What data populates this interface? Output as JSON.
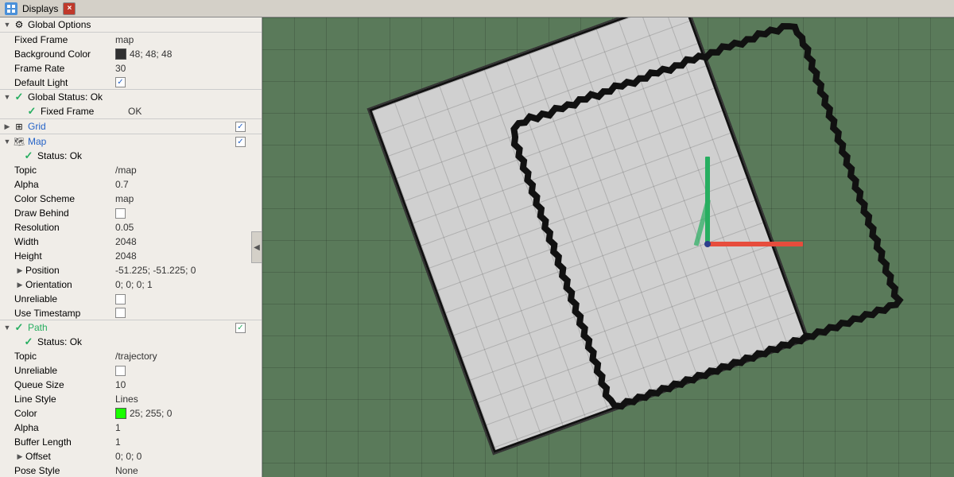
{
  "titlebar": {
    "title": "Displays",
    "close_label": "×"
  },
  "panel": {
    "global_options": {
      "label": "Global Options",
      "fixed_frame": {
        "label": "Fixed Frame",
        "value": "map"
      },
      "background_color": {
        "label": "Background Color",
        "value": "48; 48; 48",
        "swatch": "#303030"
      },
      "frame_rate": {
        "label": "Frame Rate",
        "value": "30"
      },
      "default_light": {
        "label": "Default Light",
        "checked": true
      }
    },
    "global_status": {
      "label": "Global Status: Ok",
      "fixed_frame": {
        "label": "Fixed Frame",
        "value": "OK"
      }
    },
    "grid": {
      "label": "Grid",
      "checked": true
    },
    "map": {
      "label": "Map",
      "checked": true,
      "status": {
        "label": "Status: Ok"
      },
      "topic": {
        "label": "Topic",
        "value": "/map"
      },
      "alpha": {
        "label": "Alpha",
        "value": "0.7"
      },
      "color_scheme": {
        "label": "Color Scheme",
        "value": "map"
      },
      "draw_behind": {
        "label": "Draw Behind",
        "checked": false
      },
      "resolution": {
        "label": "Resolution",
        "value": "0.05"
      },
      "width": {
        "label": "Width",
        "value": "2048"
      },
      "height": {
        "label": "Height",
        "value": "2048"
      },
      "position": {
        "label": "Position",
        "value": "-51.225; -51.225; 0"
      },
      "orientation": {
        "label": "Orientation",
        "value": "0; 0; 0; 1"
      },
      "unreliable": {
        "label": "Unreliable",
        "checked": false
      },
      "use_timestamp": {
        "label": "Use Timestamp",
        "checked": false
      }
    },
    "path": {
      "label": "Path",
      "checked": true,
      "status": {
        "label": "Status: Ok"
      },
      "topic": {
        "label": "Topic",
        "value": "/trajectory"
      },
      "unreliable": {
        "label": "Unreliable",
        "checked": false
      },
      "queue_size": {
        "label": "Queue Size",
        "value": "10"
      },
      "line_style": {
        "label": "Line Style",
        "value": "Lines"
      },
      "color": {
        "label": "Color",
        "value": "25; 255; 0",
        "swatch": "#19ff00"
      },
      "alpha": {
        "label": "Alpha",
        "value": "1"
      },
      "buffer_length": {
        "label": "Buffer Length",
        "value": "1"
      },
      "offset": {
        "label": "Offset",
        "value": "0; 0; 0"
      },
      "pose_style": {
        "label": "Pose Style",
        "value": "None"
      }
    }
  }
}
